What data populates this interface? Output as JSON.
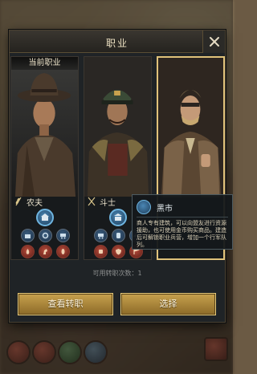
{
  "dialog": {
    "title": "职业",
    "close_label": "✕"
  },
  "cards": [
    {
      "current_label": "当前职业",
      "profession": "农夫",
      "icon": "wheat-icon",
      "main_skill_icon": "harvest-icon",
      "skills_row1": [
        "farm-icon",
        "gear-icon",
        "cart-icon"
      ],
      "skills_row2": [
        "fire-icon",
        "horse-icon",
        "grain-icon"
      ]
    },
    {
      "profession": "斗士",
      "icon": "crossed-swords-icon",
      "main_skill_icon": "market-stall-icon",
      "skills_row1": [
        "wagon-icon",
        "barrel-icon",
        "helmet-icon"
      ],
      "skills_row2": [
        "fist-icon",
        "shield-icon",
        "banner-icon"
      ]
    },
    {
      "profession": "",
      "icon": "",
      "selected": true
    }
  ],
  "tooltip": {
    "title": "黑市",
    "description": "商人专有建筑，可以向盟友进行资源援助，也可使用金币购买商品。建造后可解锁职业兵营，增加一个行军队列。"
  },
  "remaining_changes": "可用转职次数：1",
  "buttons": {
    "view": "查看转职",
    "select": "选择"
  },
  "colors": {
    "gold_button": "#c8a24e",
    "panel_bg": "#1f2326",
    "skill_blue": "#4a86b4",
    "skill_red": "#b54a3a"
  }
}
